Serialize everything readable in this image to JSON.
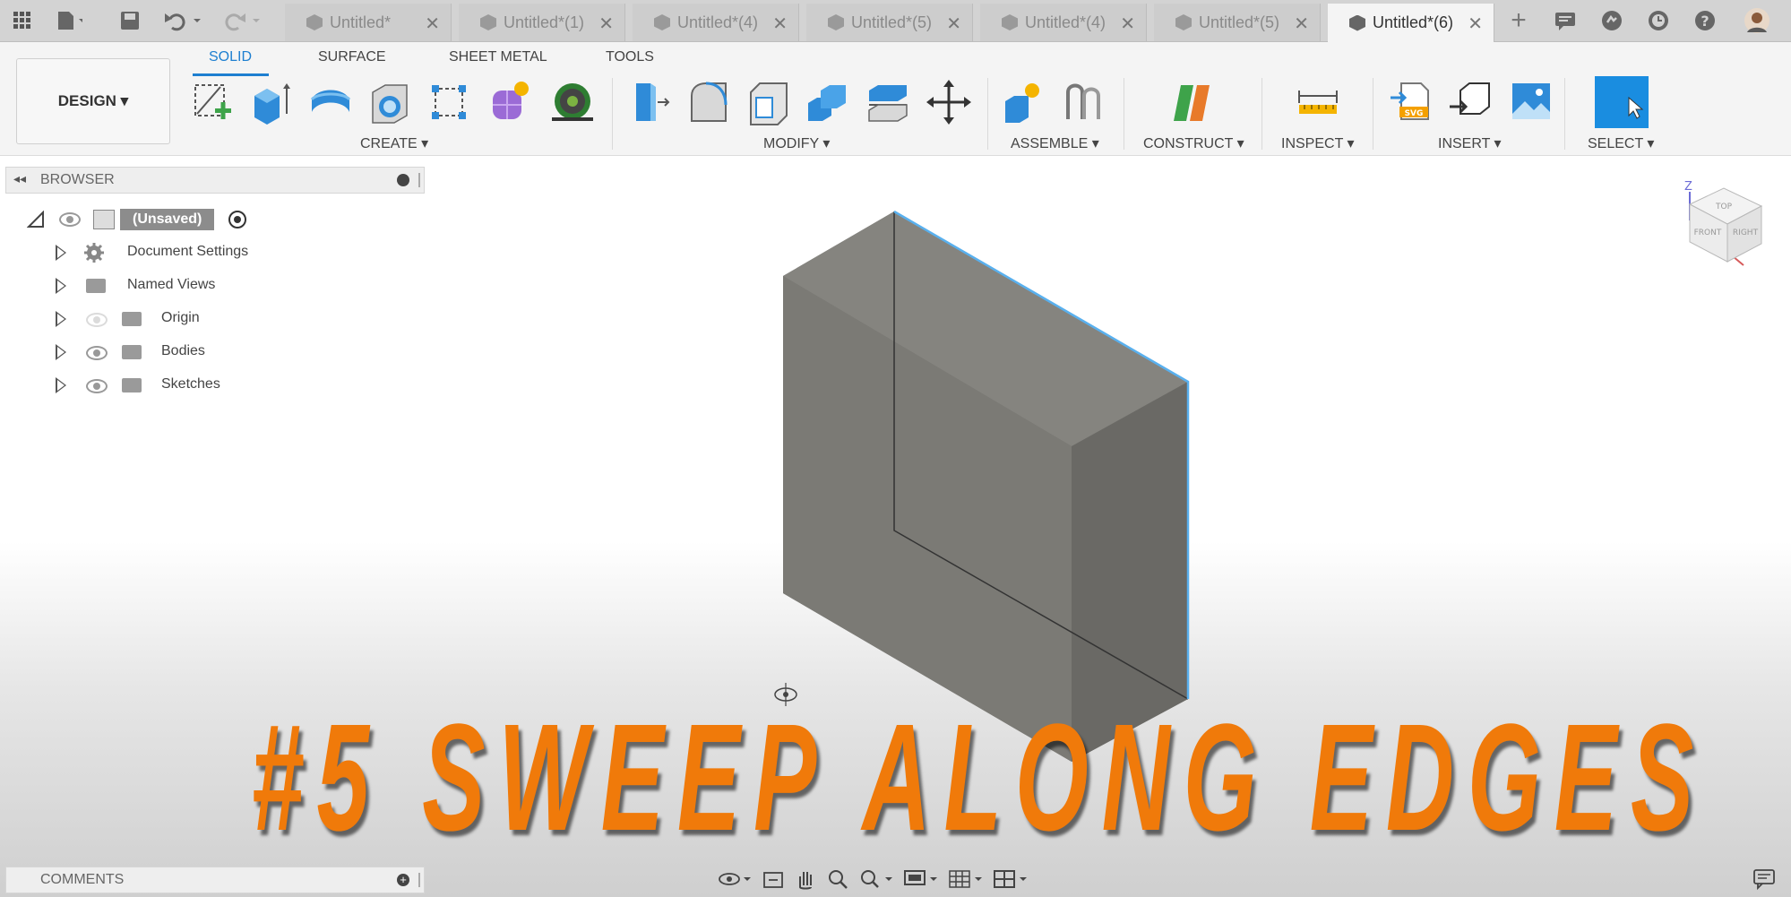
{
  "tabs": [
    {
      "label": "Untitled*",
      "active": false
    },
    {
      "label": "Untitled*(1)",
      "active": false
    },
    {
      "label": "Untitled*(4)",
      "active": false
    },
    {
      "label": "Untitled*(5)",
      "active": false
    },
    {
      "label": "Untitled*(4)",
      "active": false
    },
    {
      "label": "Untitled*(5)",
      "active": false
    },
    {
      "label": "Untitled*(6)",
      "active": true
    }
  ],
  "workspace_button": "DESIGN ▾",
  "workspace_tabs": [
    "SOLID",
    "SURFACE",
    "SHEET METAL",
    "TOOLS"
  ],
  "groups": {
    "create": "CREATE ▾",
    "modify": "MODIFY ▾",
    "assemble": "ASSEMBLE ▾",
    "construct": "CONSTRUCT ▾",
    "inspect": "INSPECT ▾",
    "insert": "INSERT ▾",
    "select": "SELECT ▾"
  },
  "browser": {
    "title": "BROWSER",
    "root": "(Unsaved)",
    "items": [
      "Document Settings",
      "Named Views",
      "Origin",
      "Bodies",
      "Sketches"
    ]
  },
  "comments": "COMMENTS",
  "viewcube": {
    "z": "Z",
    "top": "TOP",
    "front": "FRONT",
    "right": "RIGHT"
  },
  "overlay_title": "#5 SWEEP ALONG EDGES",
  "colors": {
    "accent": "#1e7fd0",
    "overlay": "#f07a0a",
    "body": "#6f6e69"
  }
}
